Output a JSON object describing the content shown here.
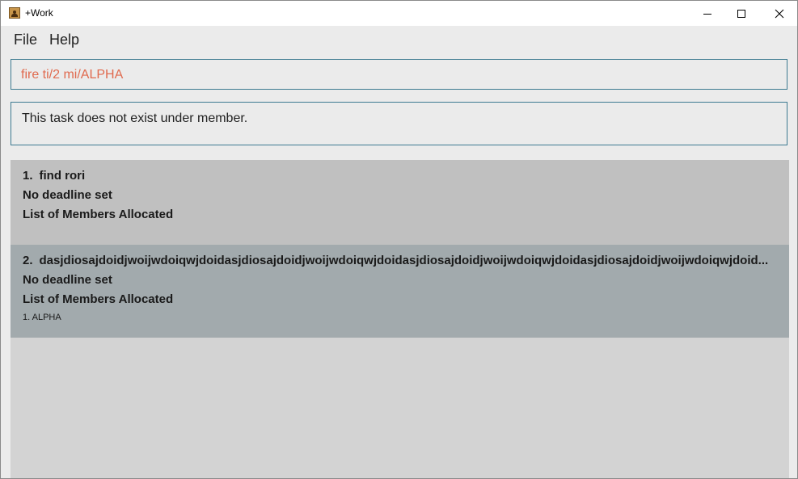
{
  "window": {
    "title": "+Work",
    "icon": "app-person-icon",
    "controls": {
      "minimize_icon": "minimize-icon",
      "maximize_icon": "maximize-icon",
      "close_icon": "close-icon"
    }
  },
  "menu": {
    "file_label": "File",
    "help_label": "Help"
  },
  "command": {
    "value": "fire ti/2 mi/ALPHA",
    "text_color": "#e06a4e"
  },
  "result": {
    "message": "This task does not exist under member."
  },
  "tasks": [
    {
      "index": "1.",
      "name": "find rori",
      "deadline": "No deadline set",
      "members_label": "List of Members Allocated",
      "members": []
    },
    {
      "index": "2.",
      "name": "dasjdiosajdoidjwoijwdoiqwjdoidasjdiosajdoidjwoijwdoiqwjdoidasjdiosajdoidjwoijwdoiqwjdoidasjdiosajdoidjwoijwdoiqwjdoid...",
      "deadline": "No deadline set",
      "members_label": "List of Members Allocated",
      "members": [
        "1. ALPHA"
      ]
    }
  ],
  "colors": {
    "accent_border": "#3e7b91",
    "card_default": "#c0c0c0",
    "card_selected": "#a2aaad",
    "list_background": "#d3d3d3"
  }
}
